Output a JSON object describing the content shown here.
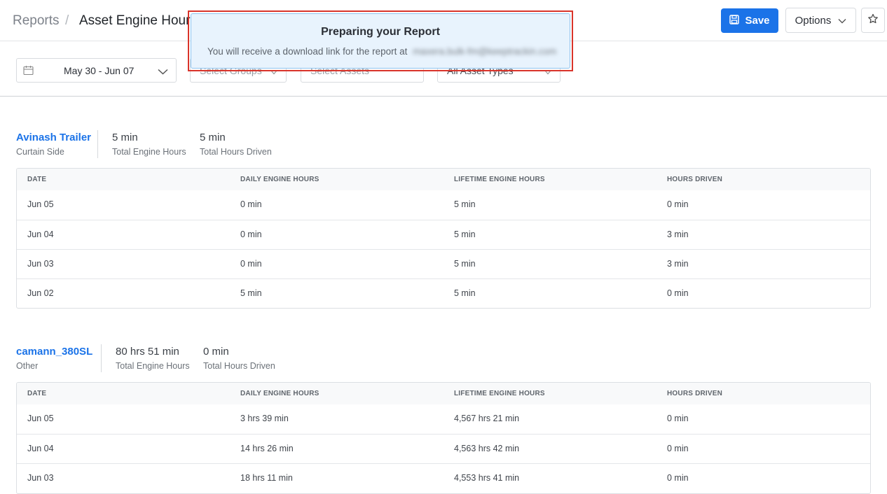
{
  "header": {
    "breadcrumb_root": "Reports",
    "breadcrumb_sep": "/",
    "title": "Asset Engine Hours",
    "save_label": "Save",
    "options_label": "Options"
  },
  "filters": {
    "date_range": "May 30 - Jun 07",
    "groups_placeholder": "Select Groups",
    "assets_placeholder": "Select Assets",
    "types_value": "All Asset Types"
  },
  "toast": {
    "title": "Preparing your Report",
    "message": "You will receive a download link for the report at",
    "email": "maxera.bulk-fm@keeptrackin.com"
  },
  "columns": [
    "DATE",
    "DAILY ENGINE HOURS",
    "LIFETIME ENGINE HOURS",
    "HOURS DRIVEN"
  ],
  "assets": [
    {
      "name": "Avinash Trailer",
      "type": "Curtain Side",
      "total_engine_hours": "5 min",
      "total_engine_hours_label": "Total Engine Hours",
      "total_hours_driven": "5 min",
      "total_hours_driven_label": "Total Hours Driven",
      "rows": [
        [
          "Jun 05",
          "0 min",
          "5 min",
          "0 min"
        ],
        [
          "Jun 04",
          "0 min",
          "5 min",
          "3 min"
        ],
        [
          "Jun 03",
          "0 min",
          "5 min",
          "3 min"
        ],
        [
          "Jun 02",
          "5 min",
          "5 min",
          "0 min"
        ]
      ]
    },
    {
      "name": "camann_380SL",
      "type": "Other",
      "total_engine_hours": "80 hrs 51 min",
      "total_engine_hours_label": "Total Engine Hours",
      "total_hours_driven": "0 min",
      "total_hours_driven_label": "Total Hours Driven",
      "rows": [
        [
          "Jun 05",
          "3 hrs 39 min",
          "4,567 hrs 21 min",
          "0 min"
        ],
        [
          "Jun 04",
          "14 hrs 26 min",
          "4,563 hrs 42 min",
          "0 min"
        ],
        [
          "Jun 03",
          "18 hrs 11 min",
          "4,553 hrs 41 min",
          "0 min"
        ]
      ]
    }
  ],
  "colors": {
    "accent": "#1b73e8",
    "toast_bg": "#e8f3fd",
    "highlight_outline": "#d9342b"
  }
}
